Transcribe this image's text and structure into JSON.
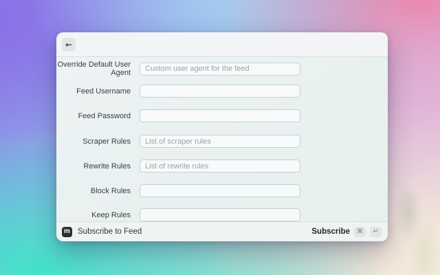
{
  "window": {
    "header": {
      "back_icon": "←"
    },
    "form": {
      "fields": [
        {
          "label": "Override Default User Agent",
          "placeholder": "Custom user agent for the feed"
        },
        {
          "label": "Feed Username",
          "placeholder": ""
        },
        {
          "label": "Feed Password",
          "placeholder": ""
        },
        {
          "label": "Scraper Rules",
          "placeholder": "List of scraper rules"
        },
        {
          "label": "Rewrite Rules",
          "placeholder": "List of rewrite rules"
        },
        {
          "label": "Block Rules",
          "placeholder": ""
        },
        {
          "label": "Keep Rules",
          "placeholder": ""
        }
      ]
    },
    "footer": {
      "app_icon_letter": "m",
      "title": "Subscribe to Feed",
      "action_label": "Subscribe",
      "shortcut_keys": [
        "⌘",
        "↵"
      ]
    }
  },
  "colors": {
    "logo_background": "#2c2f33",
    "keycap_background": "#e1e5e6",
    "input_border": "#c6ced2",
    "label_text": "#383c40",
    "placeholder_text": "#99a1a8"
  }
}
